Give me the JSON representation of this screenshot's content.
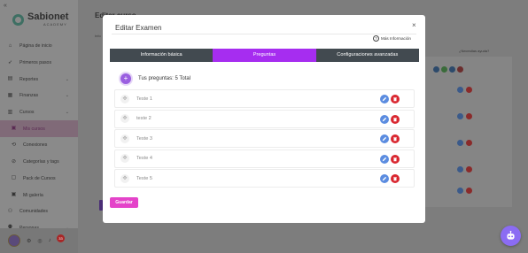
{
  "app": {
    "brand_line1": "Sabionet",
    "brand_line2": "ACADEMY",
    "collapse_icon": "«",
    "page_title": "Editar curso",
    "page_subtitle": "Info",
    "notification_count": "33",
    "check_label": "¿Necesitas ayuda?"
  },
  "sidebar": {
    "items": [
      {
        "icon": "home-icon",
        "glyph": "⌂",
        "label": "Página de inicio",
        "chevron": false
      },
      {
        "icon": "rocket-icon",
        "glyph": "➶",
        "label": "Primeros pasos",
        "chevron": false
      },
      {
        "icon": "chart-icon",
        "glyph": "▤",
        "label": "Reportes",
        "chevron": true
      },
      {
        "icon": "wallet-icon",
        "glyph": "▦",
        "label": "Finanzas",
        "chevron": true
      },
      {
        "icon": "book-icon",
        "glyph": "▥",
        "label": "Cursos",
        "chevron": true
      },
      {
        "icon": "course-icon",
        "glyph": "▣",
        "label": "Mis cursos",
        "chevron": false,
        "sub": true,
        "active": true
      },
      {
        "icon": "connection-icon",
        "glyph": "⟲",
        "label": "Conexiones",
        "chevron": false,
        "sub": true
      },
      {
        "icon": "category-icon",
        "glyph": "⊘",
        "label": "Categorías y tags",
        "chevron": false,
        "sub": true
      },
      {
        "icon": "pack-icon",
        "glyph": "▢",
        "label": "Pack de Cursos",
        "chevron": false,
        "sub": true
      },
      {
        "icon": "glossary-icon",
        "glyph": "▣",
        "label": "Mi galería",
        "chevron": false,
        "sub": true
      },
      {
        "icon": "community-icon",
        "glyph": "⚇",
        "label": "Comunidades",
        "chevron": false
      },
      {
        "icon": "people-icon",
        "glyph": "⚉",
        "label": "Personas",
        "chevron": true
      }
    ]
  },
  "modal": {
    "title": "Editar Examen",
    "close_glyph": "×",
    "more_info_label": "Más Información",
    "tabs": [
      {
        "label": "Información básica",
        "active": false
      },
      {
        "label": "Preguntas",
        "active": true
      },
      {
        "label": "Configuraciones avanzadas",
        "active": false
      }
    ],
    "add_glyph": "+",
    "questions_summary": "Tus preguntas: 5 Total",
    "questions": [
      {
        "name": "Teste 1"
      },
      {
        "name": "teste 2"
      },
      {
        "name": "Teste 3"
      },
      {
        "name": "Teste 4"
      },
      {
        "name": "Teste 5"
      }
    ],
    "drag_glyph": "✥",
    "save_label": "Guardar"
  },
  "colors": {
    "primary_purple": "#a62df0",
    "tab_dark": "#424a50",
    "edit_blue": "#5b8ce0",
    "delete_red": "#d9262f",
    "save_pink": "#e443c9",
    "fab_purple": "#8b6cf3"
  }
}
